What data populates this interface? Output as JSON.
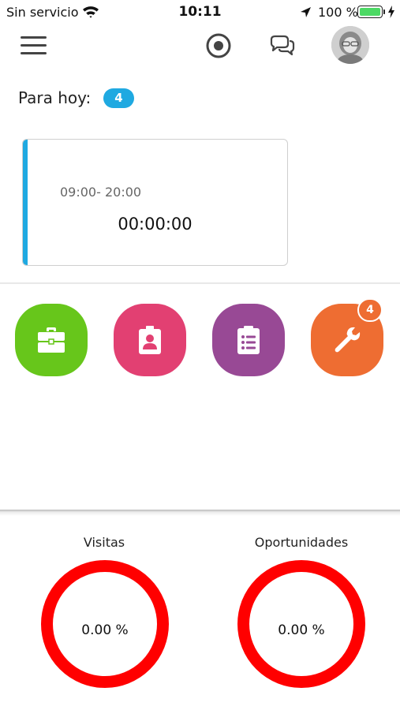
{
  "status_bar": {
    "carrier": "Sin servicio",
    "time": "10:11",
    "battery_percent": "100 %",
    "battery_level": 1.0,
    "icons": [
      "wifi-icon",
      "location-arrow-icon",
      "battery-icon",
      "charging-icon"
    ]
  },
  "app_bar": {
    "icons": [
      "hamburger-menu-icon",
      "record-icon",
      "chat-bubbles-icon",
      "avatar"
    ]
  },
  "today": {
    "label": "Para hoy:",
    "count": "4"
  },
  "shift": {
    "hours": "09:00- 20:00",
    "timer": "00:00:00",
    "accent_color": "#1fa9e1"
  },
  "modules": [
    {
      "icon": "briefcase-icon",
      "color": "#67c61b"
    },
    {
      "icon": "contact-badge-icon",
      "color": "#e24072"
    },
    {
      "icon": "clipboard-list-icon",
      "color": "#984995"
    },
    {
      "icon": "wrench-icon",
      "color": "#ee6d32",
      "badge": "4"
    }
  ],
  "stats": {
    "visits": {
      "title": "Visitas",
      "value": "0.00 %"
    },
    "opportunities": {
      "title": "Oportunidades",
      "value": "0.00 %"
    },
    "ring_color": "#ff0000"
  }
}
